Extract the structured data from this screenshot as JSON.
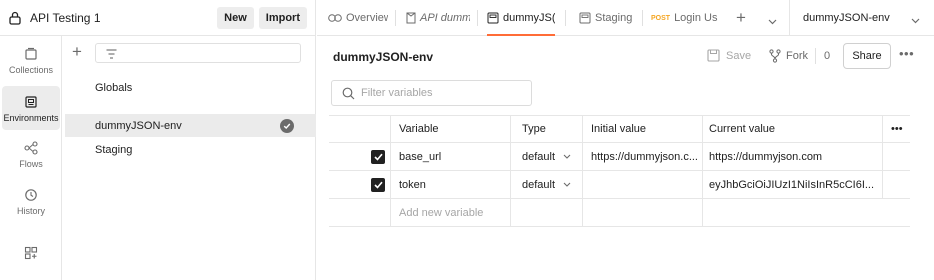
{
  "workspace": {
    "title": "API Testing 1",
    "new_label": "New",
    "import_label": "Import"
  },
  "rail": {
    "items": [
      {
        "label": "Collections",
        "icon": "collections-icon"
      },
      {
        "label": "Environments",
        "icon": "environments-icon"
      },
      {
        "label": "Flows",
        "icon": "flows-icon"
      },
      {
        "label": "History",
        "icon": "history-icon"
      },
      {
        "label": "",
        "icon": "configure-workbench-icon"
      }
    ],
    "active_index": 1
  },
  "env_list": {
    "items": [
      "Globals",
      "dummyJSON-env",
      "Staging"
    ],
    "selected": "dummyJSON-env"
  },
  "tabs": [
    {
      "label": "Overview",
      "icon": "overview-icon"
    },
    {
      "label": "API dumm",
      "icon": "api-icon"
    },
    {
      "label": "dummyJS(",
      "icon": "environment-tab-icon",
      "active": true
    },
    {
      "label": "Staging",
      "icon": "environment-tab-icon"
    },
    {
      "label": "Login Us",
      "method": "POST"
    }
  ],
  "env_selector": {
    "value": "dummyJSON-env"
  },
  "environment": {
    "name": "dummyJSON-env",
    "save_label": "Save",
    "fork_label": "Fork",
    "fork_count": "0",
    "share_label": "Share",
    "search_placeholder": "Filter variables"
  },
  "table": {
    "headers": {
      "variable": "Variable",
      "type": "Type",
      "initial": "Initial value",
      "current": "Current value"
    },
    "rows": [
      {
        "checked": true,
        "variable": "base_url",
        "type": "default",
        "initial": "https://dummyjson.c...",
        "current": "https://dummyjson.com"
      },
      {
        "checked": true,
        "variable": "token",
        "type": "default",
        "initial": "",
        "current": "eyJhbGciOiJIUzI1NiIsInR5cCI6I..."
      }
    ],
    "new_row_placeholder": "Add new variable"
  },
  "colors": {
    "accent": "#ff6c37",
    "post": "#f5a623",
    "text": "#212121",
    "muted": "#6b6b6b"
  }
}
